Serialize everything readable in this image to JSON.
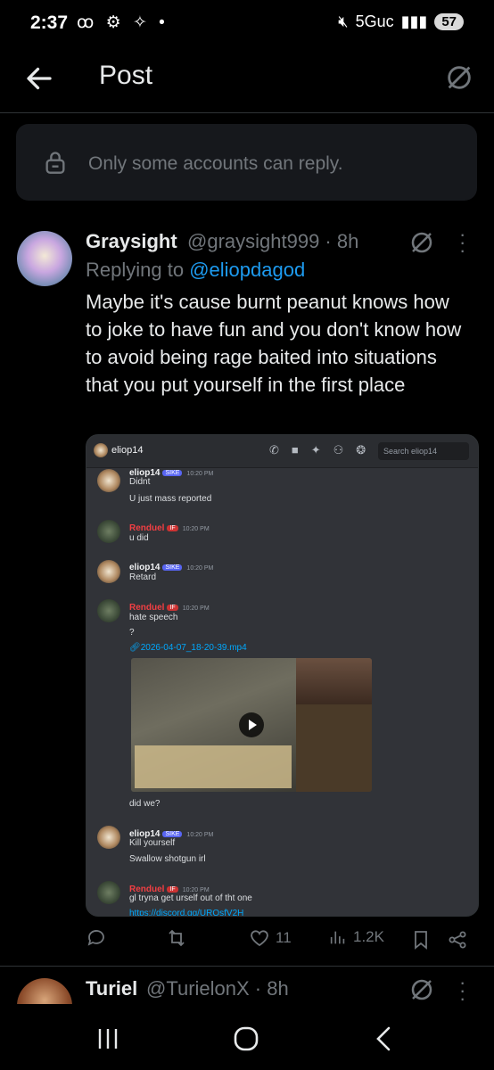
{
  "status": {
    "time": "2:37",
    "left_icons": "ꝏ ⚙ ✧ •",
    "network": "5Guc",
    "battery": "57"
  },
  "header": {
    "title": "Post"
  },
  "notice": {
    "text": "Only some accounts can reply."
  },
  "post": {
    "name": "Graysight",
    "handle": "@graysight999 · 8h",
    "replying_prefix": "Replying to ",
    "replying_to": "@eliopdagod",
    "body": "Maybe it's cause burnt peanut knows how to joke to have fun and you don't know how to avoid being rage baited into situations that you put yourself in the first place",
    "image": {
      "channel": "eliop14",
      "search_placeholder": "Search eliop14",
      "messages": [
        {
          "user": "eliop14",
          "tag": "SIKE",
          "time": "10:20 PM",
          "lines": [
            "Didnt",
            "U just mass reported"
          ],
          "kind": "eli"
        },
        {
          "user": "Renduel",
          "tag": "IF",
          "time": "10:20 PM",
          "lines": [
            "u did"
          ],
          "kind": "ren"
        },
        {
          "user": "eliop14",
          "tag": "SIKE",
          "time": "10:20 PM",
          "lines": [
            "Retard"
          ],
          "kind": "eli"
        },
        {
          "user": "Renduel",
          "tag": "IF",
          "time": "10:20 PM",
          "lines": [
            "hate speech",
            "?"
          ],
          "kind": "ren"
        }
      ],
      "attachment": "2026-04-07_18-20-39.mp4",
      "after_video": "did we?",
      "messages2": [
        {
          "user": "eliop14",
          "tag": "SIKE",
          "time": "10:20 PM",
          "lines": [
            "Kill yourself",
            "Swallow shotgun irl"
          ],
          "kind": "eli"
        },
        {
          "user": "Renduel",
          "tag": "IF",
          "time": "10:20 PM",
          "lines": [
            "gl tryna get urself out of tht one"
          ],
          "kind": "ren"
        }
      ],
      "link_partial": "https://discord.gg/URQsfV2H"
    },
    "actions": {
      "replies": "",
      "reposts": "",
      "likes": "11",
      "views": "1.2K"
    }
  },
  "post2": {
    "name": "Turiel",
    "handle": "@TurielonX · 8h"
  },
  "colors": {
    "accent": "#1d9bf0",
    "muted": "#71767b",
    "bg": "#000000"
  }
}
